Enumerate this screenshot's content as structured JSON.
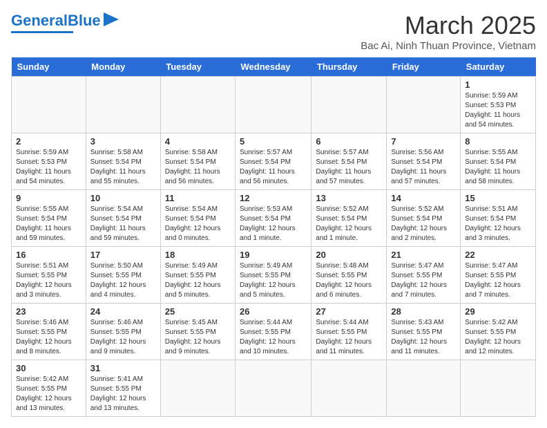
{
  "header": {
    "logo_general": "General",
    "logo_blue": "Blue",
    "month_title": "March 2025",
    "location": "Bac Ai, Ninh Thuan Province, Vietnam"
  },
  "weekdays": [
    "Sunday",
    "Monday",
    "Tuesday",
    "Wednesday",
    "Thursday",
    "Friday",
    "Saturday"
  ],
  "weeks": [
    [
      {
        "day": "",
        "info": ""
      },
      {
        "day": "",
        "info": ""
      },
      {
        "day": "",
        "info": ""
      },
      {
        "day": "",
        "info": ""
      },
      {
        "day": "",
        "info": ""
      },
      {
        "day": "",
        "info": ""
      },
      {
        "day": "1",
        "info": "Sunrise: 5:59 AM\nSunset: 5:53 PM\nDaylight: 11 hours and 54 minutes."
      }
    ],
    [
      {
        "day": "2",
        "info": "Sunrise: 5:59 AM\nSunset: 5:53 PM\nDaylight: 11 hours and 54 minutes."
      },
      {
        "day": "3",
        "info": "Sunrise: 5:58 AM\nSunset: 5:54 PM\nDaylight: 11 hours and 55 minutes."
      },
      {
        "day": "4",
        "info": "Sunrise: 5:58 AM\nSunset: 5:54 PM\nDaylight: 11 hours and 56 minutes."
      },
      {
        "day": "5",
        "info": "Sunrise: 5:57 AM\nSunset: 5:54 PM\nDaylight: 11 hours and 56 minutes."
      },
      {
        "day": "6",
        "info": "Sunrise: 5:57 AM\nSunset: 5:54 PM\nDaylight: 11 hours and 57 minutes."
      },
      {
        "day": "7",
        "info": "Sunrise: 5:56 AM\nSunset: 5:54 PM\nDaylight: 11 hours and 57 minutes."
      },
      {
        "day": "8",
        "info": "Sunrise: 5:55 AM\nSunset: 5:54 PM\nDaylight: 11 hours and 58 minutes."
      }
    ],
    [
      {
        "day": "9",
        "info": "Sunrise: 5:55 AM\nSunset: 5:54 PM\nDaylight: 11 hours and 59 minutes."
      },
      {
        "day": "10",
        "info": "Sunrise: 5:54 AM\nSunset: 5:54 PM\nDaylight: 11 hours and 59 minutes."
      },
      {
        "day": "11",
        "info": "Sunrise: 5:54 AM\nSunset: 5:54 PM\nDaylight: 12 hours and 0 minutes."
      },
      {
        "day": "12",
        "info": "Sunrise: 5:53 AM\nSunset: 5:54 PM\nDaylight: 12 hours and 1 minute."
      },
      {
        "day": "13",
        "info": "Sunrise: 5:52 AM\nSunset: 5:54 PM\nDaylight: 12 hours and 1 minute."
      },
      {
        "day": "14",
        "info": "Sunrise: 5:52 AM\nSunset: 5:54 PM\nDaylight: 12 hours and 2 minutes."
      },
      {
        "day": "15",
        "info": "Sunrise: 5:51 AM\nSunset: 5:54 PM\nDaylight: 12 hours and 3 minutes."
      }
    ],
    [
      {
        "day": "16",
        "info": "Sunrise: 5:51 AM\nSunset: 5:55 PM\nDaylight: 12 hours and 3 minutes."
      },
      {
        "day": "17",
        "info": "Sunrise: 5:50 AM\nSunset: 5:55 PM\nDaylight: 12 hours and 4 minutes."
      },
      {
        "day": "18",
        "info": "Sunrise: 5:49 AM\nSunset: 5:55 PM\nDaylight: 12 hours and 5 minutes."
      },
      {
        "day": "19",
        "info": "Sunrise: 5:49 AM\nSunset: 5:55 PM\nDaylight: 12 hours and 5 minutes."
      },
      {
        "day": "20",
        "info": "Sunrise: 5:48 AM\nSunset: 5:55 PM\nDaylight: 12 hours and 6 minutes."
      },
      {
        "day": "21",
        "info": "Sunrise: 5:47 AM\nSunset: 5:55 PM\nDaylight: 12 hours and 7 minutes."
      },
      {
        "day": "22",
        "info": "Sunrise: 5:47 AM\nSunset: 5:55 PM\nDaylight: 12 hours and 7 minutes."
      }
    ],
    [
      {
        "day": "23",
        "info": "Sunrise: 5:46 AM\nSunset: 5:55 PM\nDaylight: 12 hours and 8 minutes."
      },
      {
        "day": "24",
        "info": "Sunrise: 5:46 AM\nSunset: 5:55 PM\nDaylight: 12 hours and 9 minutes."
      },
      {
        "day": "25",
        "info": "Sunrise: 5:45 AM\nSunset: 5:55 PM\nDaylight: 12 hours and 9 minutes."
      },
      {
        "day": "26",
        "info": "Sunrise: 5:44 AM\nSunset: 5:55 PM\nDaylight: 12 hours and 10 minutes."
      },
      {
        "day": "27",
        "info": "Sunrise: 5:44 AM\nSunset: 5:55 PM\nDaylight: 12 hours and 11 minutes."
      },
      {
        "day": "28",
        "info": "Sunrise: 5:43 AM\nSunset: 5:55 PM\nDaylight: 12 hours and 11 minutes."
      },
      {
        "day": "29",
        "info": "Sunrise: 5:42 AM\nSunset: 5:55 PM\nDaylight: 12 hours and 12 minutes."
      }
    ],
    [
      {
        "day": "30",
        "info": "Sunrise: 5:42 AM\nSunset: 5:55 PM\nDaylight: 12 hours and 13 minutes."
      },
      {
        "day": "31",
        "info": "Sunrise: 5:41 AM\nSunset: 5:55 PM\nDaylight: 12 hours and 13 minutes."
      },
      {
        "day": "",
        "info": ""
      },
      {
        "day": "",
        "info": ""
      },
      {
        "day": "",
        "info": ""
      },
      {
        "day": "",
        "info": ""
      },
      {
        "day": "",
        "info": ""
      }
    ]
  ]
}
